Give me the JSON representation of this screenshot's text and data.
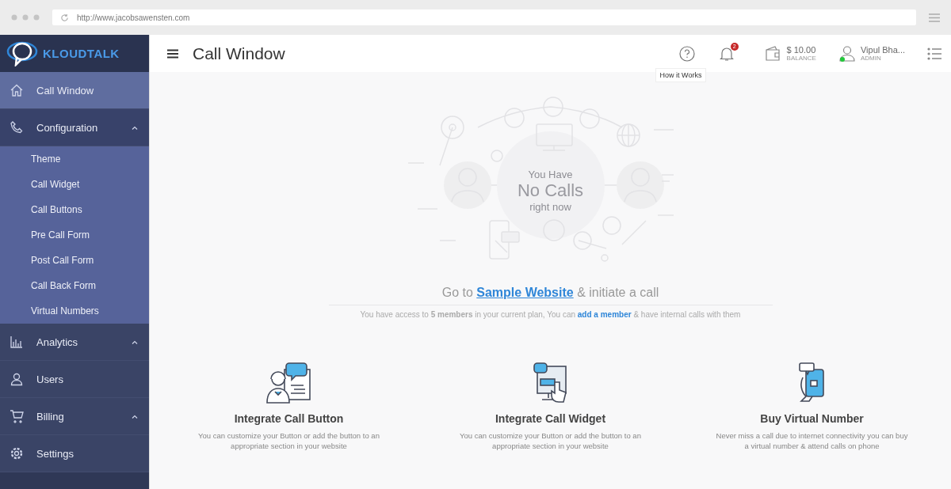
{
  "browser": {
    "url": "http://www.jacobsawensten.com"
  },
  "sidebar": {
    "logo": "KLOUDTALK",
    "items": [
      {
        "kind": "link",
        "label": "Call Window",
        "selected": true
      },
      {
        "kind": "group",
        "label": "Configuration",
        "selected": false,
        "expanded": true,
        "children": [
          {
            "label": "Theme"
          },
          {
            "label": "Call Widget"
          },
          {
            "label": "Call Buttons"
          },
          {
            "label": "Pre Call Form"
          },
          {
            "label": "Post Call Form"
          },
          {
            "label": "Call Back Form"
          },
          {
            "label": "Virtual Numbers"
          }
        ]
      },
      {
        "kind": "group",
        "label": "Analytics",
        "selected": false
      },
      {
        "kind": "link",
        "label": "Users",
        "selected": false
      },
      {
        "kind": "group",
        "label": "Billing",
        "selected": false
      },
      {
        "kind": "link",
        "label": "Settings",
        "selected": false
      }
    ]
  },
  "header": {
    "title": "Call Window",
    "help_tooltip": "How it Works",
    "notifications": "2",
    "balance": "$ 10.00",
    "balance_label": "BALANCE",
    "user": "Vipul Bha...",
    "role": "ADMIN",
    "online": true
  },
  "empty_state": {
    "line_1": "You Have",
    "line_2": "No Calls",
    "line_3": "right now"
  },
  "go_to": {
    "before": "Go to",
    "link": "Sample Website",
    "after": "& initiate a call"
  },
  "access_note": {
    "before": "You have access to **5 members** in your current plan, You can",
    "link": "add a member",
    "after": "& have internal calls with them"
  },
  "cards": [
    {
      "kind": "button",
      "title": "Integrate Call Button",
      "text": "You can customize your Button or add the button to an appropriate section in your website"
    },
    {
      "kind": "widget",
      "title": "Integrate Call Widget",
      "text": "You can customize your Button or add the button to an appropriate section in your website"
    },
    {
      "kind": "number",
      "title": "Buy Virtual Number",
      "text": "Never miss a call due to internet connectivity you can buy a virtual number & attend calls on phone"
    }
  ]
}
